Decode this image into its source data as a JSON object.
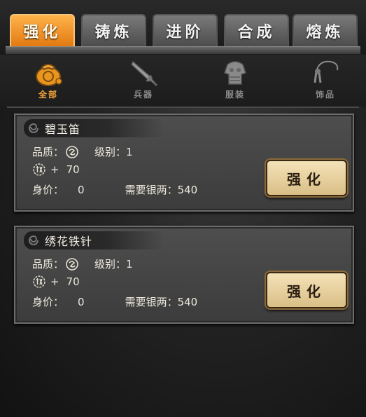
{
  "tabs": [
    {
      "label": "强化",
      "active": true
    },
    {
      "label": "铸炼",
      "active": false
    },
    {
      "label": "进阶",
      "active": false
    },
    {
      "label": "合成",
      "active": false
    },
    {
      "label": "熔炼",
      "active": false
    }
  ],
  "subtabs": [
    {
      "label": "全部",
      "icon": "bag-icon",
      "active": true
    },
    {
      "label": "兵器",
      "icon": "sword-icon",
      "active": false
    },
    {
      "label": "服装",
      "icon": "armor-icon",
      "active": false
    },
    {
      "label": "饰品",
      "icon": "amulet-icon",
      "active": false
    }
  ],
  "labels": {
    "quality": "品质：",
    "level": "级别：",
    "price": "身价：",
    "silver": "需要银两：",
    "plus": "+"
  },
  "items": [
    {
      "name": "碧玉笛",
      "level": "1",
      "attack": "70",
      "price": "0",
      "silver": "540",
      "button": "强化"
    },
    {
      "name": "绣花铁针",
      "level": "1",
      "attack": "70",
      "price": "0",
      "silver": "540",
      "button": "强化"
    }
  ],
  "colors": {
    "active_tab": "#e27a12",
    "active_subtab_label": "#f0a23a",
    "button_bg": "#f4e2b8"
  }
}
